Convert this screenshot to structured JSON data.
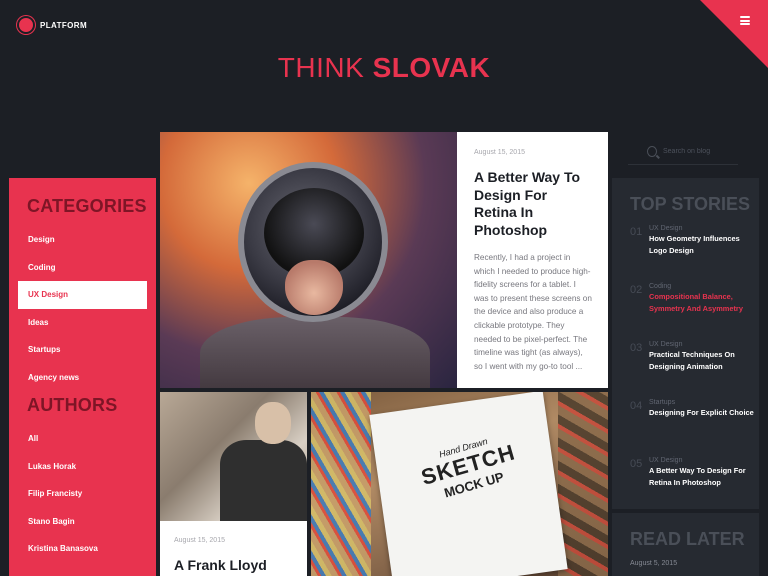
{
  "brand": {
    "name": "PLATFORM"
  },
  "title": {
    "light": "THINK",
    "bold": "SLOVAK"
  },
  "search": {
    "placeholder": "Search on blog"
  },
  "sidebar": {
    "categories_heading": "CATEGORIES",
    "categories": [
      "Design",
      "Coding",
      "UX Design",
      "Ideas",
      "Startups",
      "Agency news"
    ],
    "active_category": "UX Design",
    "authors_heading": "AUTHORS",
    "authors": [
      "All",
      "Lukas Horak",
      "Filip Francisty",
      "Stano Bagin",
      "Kristina Banasova"
    ]
  },
  "featured": {
    "date": "August 15, 2015",
    "title": "A Better Way To Design For Retina In Photoshop",
    "excerpt": "Recently, I had a project in which I needed to produce high-fidelity screens for a tablet. I was to present these screens on the device and also produce a clickable prototype. They needed to be pixel-perfect. The timeline was tight (as always), so I went with my go-to tool ..."
  },
  "card_a": {
    "date": "August 15, 2015",
    "title": "A Frank Lloyd"
  },
  "card_b": {
    "line1": "Hand Drawn",
    "line2": "SKETCH",
    "line3": "MOCK UP"
  },
  "top_stories": {
    "heading": "TOP STORIES",
    "items": [
      {
        "num": "01",
        "category": "UX Design",
        "title": "How Geometry Influences Logo Design"
      },
      {
        "num": "02",
        "category": "Coding",
        "title": "Compositional Balance, Symmetry And Asymmetry"
      },
      {
        "num": "03",
        "category": "UX Design",
        "title": "Practical Techniques On Designing Animation"
      },
      {
        "num": "04",
        "category": "Startups",
        "title": "Designing For Explicit Choice"
      },
      {
        "num": "05",
        "category": "UX Design",
        "title": "A Better Way To Design For Retina In Photoshop"
      }
    ]
  },
  "read_later": {
    "heading": "READ LATER",
    "date": "August 5, 2015"
  },
  "colors": {
    "accent": "#e8334f",
    "background": "#1c1f25",
    "panel": "#262a31"
  }
}
